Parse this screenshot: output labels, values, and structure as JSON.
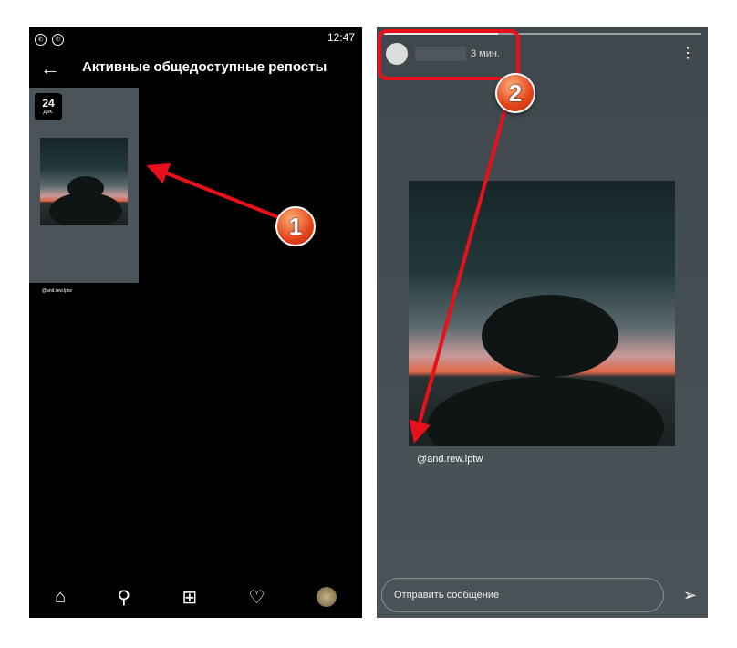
{
  "left_screen": {
    "status_time": "12:47",
    "title": "Активные общедоступные репосты",
    "story_card": {
      "day": "24",
      "month": "дек.",
      "handle": "@and.rew.lptw"
    },
    "nav": [
      "home-icon",
      "search-icon",
      "add-icon",
      "heart-icon",
      "profile-avatar"
    ]
  },
  "right_screen": {
    "time_ago": "3 мин.",
    "handle": "@and.rew.lptw",
    "message_placeholder": "Отправить сообщение"
  },
  "annotations": {
    "badge1": "1",
    "badge2": "2",
    "color": "#e8101a"
  }
}
